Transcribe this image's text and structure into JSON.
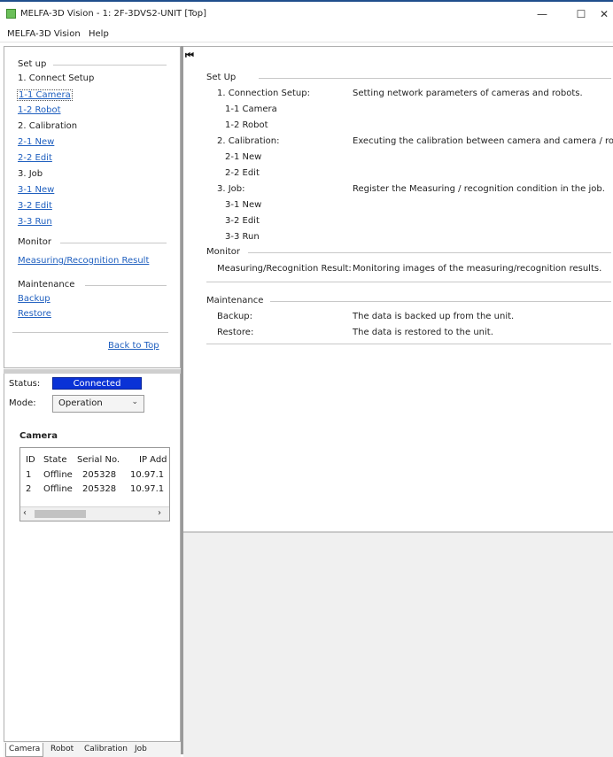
{
  "window": {
    "title": "MELFA-3D Vision - 1: 2F-3DVS2-UNIT [Top]",
    "minimize": "—",
    "maximize": "☐",
    "close": "✕"
  },
  "menubar": {
    "items": [
      "MELFA-3D Vision",
      "Help"
    ]
  },
  "nav": {
    "setup_header": "Set up",
    "connect_setup": "1. Connect Setup",
    "camera_link": "1-1 Camera",
    "robot_link": "1-2 Robot",
    "calibration": "2. Calibration",
    "calib_new": "2-1 New",
    "calib_edit": "2-2 Edit",
    "job": "3. Job",
    "job_new": "3-1 New",
    "job_edit": "3-2 Edit",
    "job_run": "3-3 Run",
    "monitor_header": "Monitor",
    "measuring_link": "Measuring/Recognition Result",
    "maintenance_header": "Maintenance",
    "backup_link": "Backup",
    "restore_link": "Restore",
    "back_to_top": "Back to Top"
  },
  "status": {
    "label": "Status:",
    "value": "Connected",
    "color": "#0a32d6"
  },
  "mode": {
    "label": "Mode:",
    "value": "Operation"
  },
  "camera": {
    "title": "Camera",
    "columns": [
      "ID",
      "State",
      "Serial No.",
      "IP Add"
    ],
    "rows": [
      [
        "1",
        "Offline",
        "205328",
        "10.97.1"
      ],
      [
        "2",
        "Offline",
        "205328",
        "10.97.1"
      ]
    ]
  },
  "bottom_tabs": [
    "Camera",
    "Robot",
    "Calibration",
    "Job"
  ],
  "content": {
    "setup_header": "Set Up",
    "connection_setup": "1. Connection Setup:",
    "connection_setup_desc": "Setting network parameters of cameras and robots.",
    "camera": "1-1 Camera",
    "robot": "1-2 Robot",
    "calibration": "2. Calibration:",
    "calibration_desc": "Executing the calibration between camera and camera / robot",
    "calib_new": "2-1 New",
    "calib_edit": "2-2 Edit",
    "job": "3. Job:",
    "job_desc": "Register the Measuring / recognition condition in the job.",
    "job_new": "3-1 New",
    "job_edit": "3-2 Edit",
    "job_run": "3-3 Run",
    "monitor_header": "Monitor",
    "measuring": "Measuring/Recognition Result:",
    "measuring_desc": "Monitoring images of the measuring/recognition results.",
    "maintenance_header": "Maintenance",
    "backup": "Backup:",
    "backup_desc": "The data is backed up from the unit.",
    "restore": "Restore:",
    "restore_desc": "The data is restored to the unit."
  }
}
